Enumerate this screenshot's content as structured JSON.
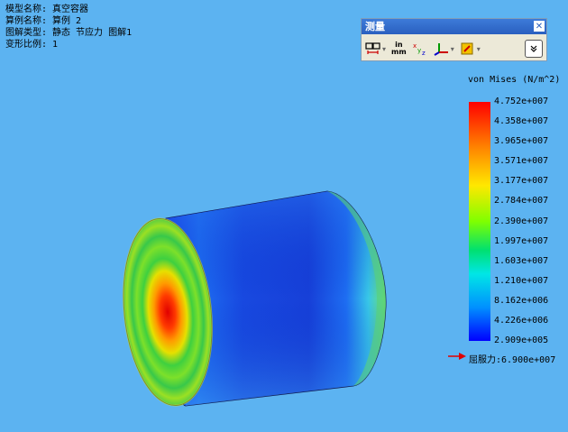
{
  "info": {
    "model_name": "模型名称: 真空容器",
    "case_name": "算例名称: 算例 2",
    "plot_type": "图解类型: 静态 节应力 图解1",
    "deform_scale": "变形比例: 1"
  },
  "measure": {
    "title": "测量",
    "units_top": "in",
    "units_bottom": "mm",
    "xyz_label": "xyz",
    "icons": [
      "measure-icon",
      "units-icon",
      "xyz-icon",
      "coordinate-system-icon",
      "project-icon",
      "expand-icon"
    ]
  },
  "legend": {
    "title": "von Mises (N/m^2)",
    "ticks": [
      "4.752e+007",
      "4.358e+007",
      "3.965e+007",
      "3.571e+007",
      "3.177e+007",
      "2.784e+007",
      "2.390e+007",
      "1.997e+007",
      "1.603e+007",
      "1.210e+007",
      "8.162e+006",
      "4.226e+006",
      "2.909e+005"
    ],
    "colors": [
      "#ff0000",
      "#ff8a00",
      "#ffe800",
      "#7fff00",
      "#00e070",
      "#00e6e6",
      "#0090ff",
      "#0000ff"
    ]
  },
  "yield": {
    "label": "屈服力:6.900e+007",
    "arrow_color": "#e00000"
  },
  "colors": {
    "background": "#5cb3f1"
  }
}
